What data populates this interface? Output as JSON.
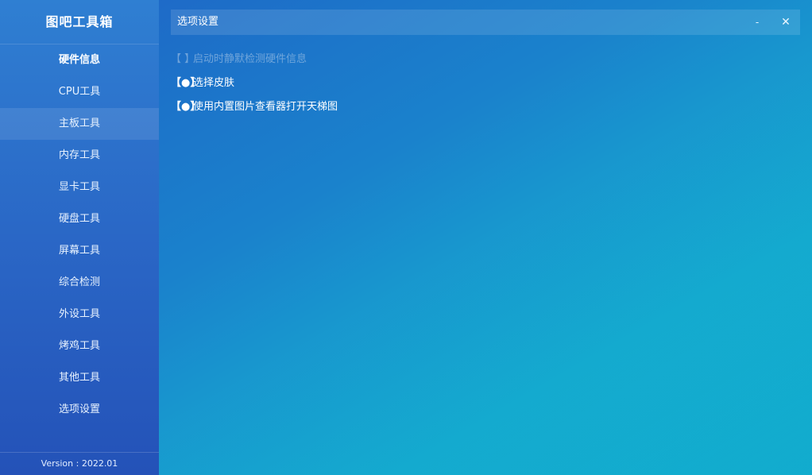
{
  "app": {
    "title": "图吧工具箱",
    "version": "Version : 2022.01"
  },
  "sidebar": {
    "items": [
      {
        "label": "硬件信息"
      },
      {
        "label": "CPU工具"
      },
      {
        "label": "主板工具"
      },
      {
        "label": "内存工具"
      },
      {
        "label": "显卡工具"
      },
      {
        "label": "硬盘工具"
      },
      {
        "label": "屏幕工具"
      },
      {
        "label": "综合检测"
      },
      {
        "label": "外设工具"
      },
      {
        "label": "烤鸡工具"
      },
      {
        "label": "其他工具"
      },
      {
        "label": "选项设置"
      }
    ],
    "active_index": 2
  },
  "window": {
    "title": "选项设置",
    "minimize_glyph": "-",
    "close_glyph": "✕"
  },
  "options": [
    {
      "mark": "【  】",
      "label": "启动时静默检测硬件信息",
      "checked": false
    },
    {
      "mark": "【●】",
      "label": "选择皮肤",
      "checked": true
    },
    {
      "mark": "【●】",
      "label": "使用内置图片查看器打开天梯图",
      "checked": true
    }
  ],
  "icons": {
    "minimize": "minimize-icon",
    "close": "close-icon"
  },
  "colors": {
    "gradient_start": "#1f63c6",
    "gradient_end": "#13c4d6",
    "sidebar_top": "#2f7fd2",
    "sidebar_bottom": "#2452b8",
    "text": "#ffffff"
  }
}
